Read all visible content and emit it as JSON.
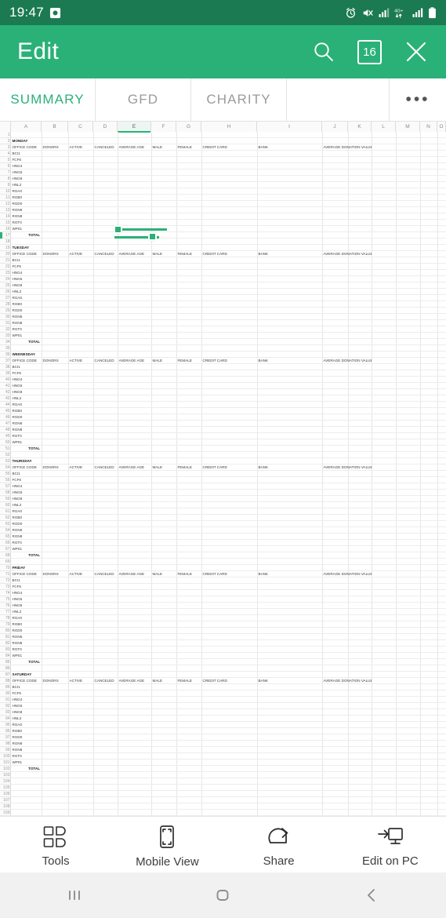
{
  "statusbar": {
    "time": "19:47",
    "icons": [
      "screen-record-icon",
      "alarm-icon",
      "mute-icon",
      "signal-icon",
      "network-4g-plus-icon",
      "signal-2-icon",
      "battery-icon"
    ],
    "network_label": "4G+"
  },
  "appbar": {
    "title": "Edit",
    "search_label": "search-icon",
    "font_size_badge": "16",
    "close_label": "close-icon",
    "bg": "#2ab177"
  },
  "tabs": {
    "items": [
      {
        "label": "SUMMARY",
        "active": true
      },
      {
        "label": "GFD",
        "active": false
      },
      {
        "label": "CHARITY",
        "active": false
      },
      {
        "label": "",
        "active": false
      }
    ],
    "more_label": "•••",
    "active_color": "#2ab177",
    "inactive_color": "#9b9b9b"
  },
  "sheet": {
    "columns": [
      "A",
      "B",
      "C",
      "D",
      "E",
      "F",
      "G",
      "H",
      "I",
      "J",
      "K",
      "L",
      "M",
      "N",
      "O"
    ],
    "selected_column": "E",
    "selection": {
      "range": "E16:E17",
      "color": "#2ab177"
    },
    "first_row": 1,
    "last_row": 110,
    "header_row": [
      "OFFICE CODE",
      "DONORS",
      "ACTIVE",
      "CANCELED",
      "AVERAGE AGE",
      "MALE",
      "FEMALE",
      "CREDIT CARD",
      "BANK",
      "AVERAGE DONATION VALUE"
    ],
    "office_codes": [
      "BCI1",
      "FCF6",
      "HNG4",
      "HNG5",
      "HNG8",
      "HNL2",
      "RGA0",
      "RGB0",
      "RGD0",
      "RGN6",
      "RGN8",
      "RGT0",
      "WP01"
    ],
    "total_label": "TOTAL",
    "days": [
      {
        "name": "MONDAY",
        "title_row": 2,
        "header_row": 3,
        "first_code_row": 4,
        "total_row": 17
      },
      {
        "name": "TUESDAY",
        "title_row": 19,
        "header_row": 20,
        "first_code_row": 21,
        "total_row": 34
      },
      {
        "name": "WEDNESDAY",
        "title_row": 36,
        "header_row": 37,
        "first_code_row": 38,
        "total_row": 51
      },
      {
        "name": "THURSDAY",
        "title_row": 53,
        "header_row": 54,
        "first_code_row": 55,
        "total_row": 68
      },
      {
        "name": "FRIDAY",
        "title_row": 70,
        "header_row": 71,
        "first_code_row": 72,
        "total_row": 85
      },
      {
        "name": "SATURDAY",
        "title_row": 87,
        "header_row": 88,
        "first_code_row": 89,
        "total_row": 102
      }
    ]
  },
  "bottombar": {
    "items": [
      {
        "label": "Tools",
        "icon": "tools-grid-icon"
      },
      {
        "label": "Mobile View",
        "icon": "mobile-view-icon"
      },
      {
        "label": "Share",
        "icon": "share-icon"
      },
      {
        "label": "Edit on PC",
        "icon": "edit-on-pc-icon"
      }
    ]
  },
  "navbar": {
    "recents": "recents-icon",
    "home": "home-icon",
    "back": "back-icon"
  }
}
